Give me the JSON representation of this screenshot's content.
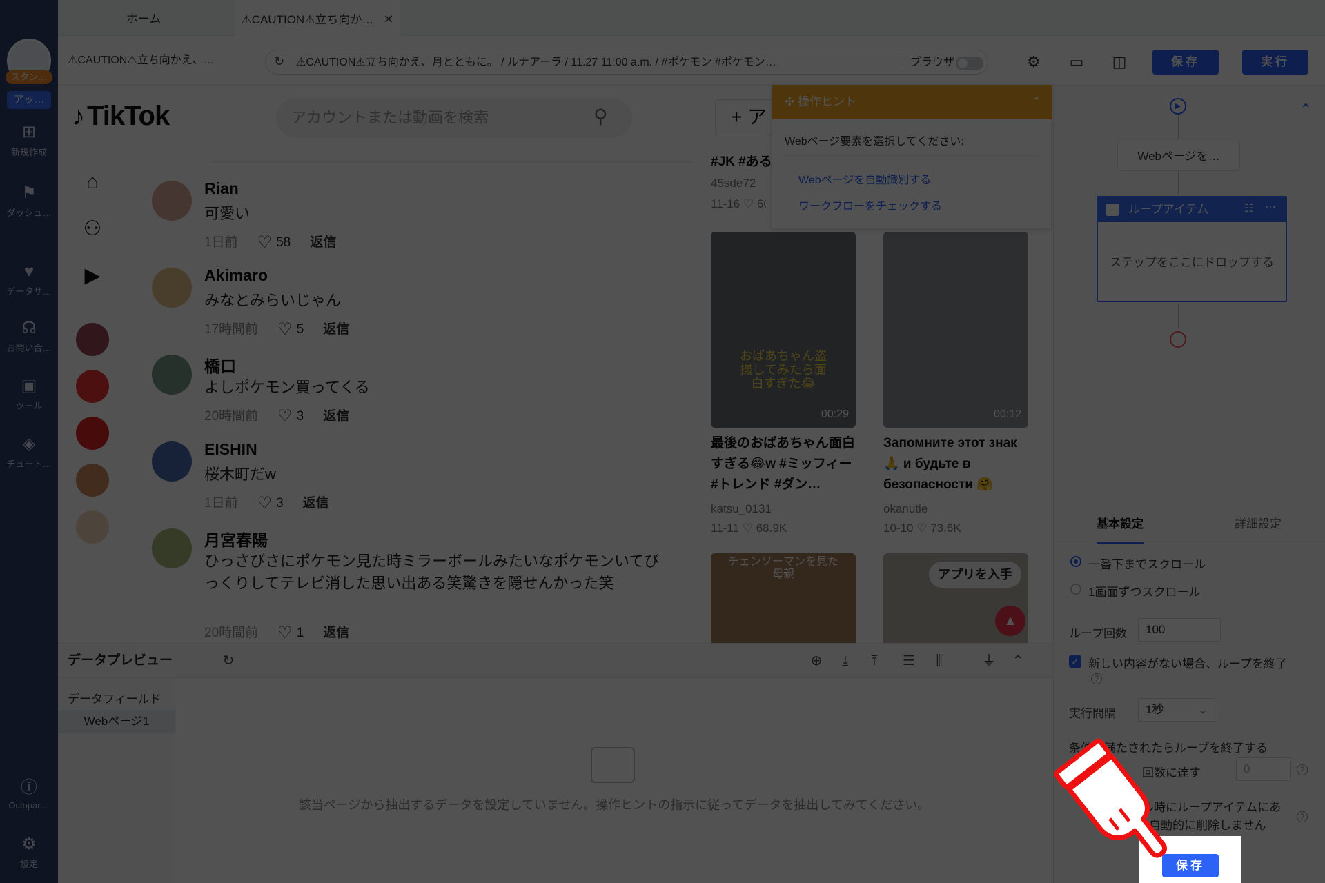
{
  "sidebar": {
    "profile_badge": "スタン…",
    "app_badge": "アッ…",
    "items": [
      {
        "label": "新規作成",
        "icon": "plus-icon"
      },
      {
        "label": "ダッシュ…",
        "icon": "dashboard-icon"
      },
      {
        "label": "データサ…",
        "icon": "data-icon"
      },
      {
        "label": "お問い合…",
        "icon": "headset-icon"
      },
      {
        "label": "ツール",
        "icon": "toolbox-icon"
      },
      {
        "label": "チュート…",
        "icon": "graduation-cap-icon"
      }
    ],
    "bottom_items": [
      {
        "label": "Octopar…",
        "icon": "info-icon"
      },
      {
        "label": "設定",
        "icon": "gear-icon"
      }
    ]
  },
  "tabs": [
    {
      "label": "ホーム"
    },
    {
      "label": "⚠CAUTION⚠立ち向か…"
    }
  ],
  "toolbar": {
    "breadcrumb": "⚠CAUTION⚠立ち向かえ、…",
    "url": "⚠CAUTION⚠立ち向かえ、月とともに。 / ルナアーラ / 11.27 11:00 a.m. / #ポケモン #ポケモン…",
    "browser_label": "ブラウザ",
    "save_label": "保存",
    "run_label": "実行"
  },
  "tiktok": {
    "logo": "TikTok",
    "search_placeholder": "アカウントまたは動画を検索",
    "upload_label": "+ ア",
    "comments": [
      {
        "name": "Rian",
        "text": "可愛い",
        "time": "1日前",
        "likes": "58",
        "reply": "返信"
      },
      {
        "name": "Akimaro",
        "text": "みなとみらいじゃん",
        "time": "17時間前",
        "likes": "5",
        "reply": "返信"
      },
      {
        "name": "橋口",
        "text": "よしポケモン買ってくる",
        "time": "20時間前",
        "likes": "3",
        "reply": "返信"
      },
      {
        "name": "EISHIN",
        "text": "桜木町だw",
        "time": "1日前",
        "likes": "3",
        "reply": "返信"
      },
      {
        "name": "月宮春陽",
        "text": "ひっさびさにポケモン見た時ミラーボールみたいなポケモンいてびっくりしてテレビ消した思い出ある笑驚きを隠せんかった笑",
        "time": "20時間前",
        "likes": "1",
        "reply": "返信"
      }
    ],
    "videos": [
      {
        "title": "#JK #ある",
        "author": "45sde72",
        "date": "11-16",
        "likes": "60"
      },
      {
        "title": "最後のおばあちゃん面白すぎる😂w #ミッフィー #トレンド #ダン…",
        "author": "katsu_0131",
        "date": "11-11",
        "likes": "68.9K",
        "duration": "00:29",
        "overlay": "おばあちゃん盗撮してみたら面白すぎた😂"
      },
      {
        "title": "Запомните этот знак 🙏 и будьте в безопасности 🤗",
        "author": "okanutie",
        "date": "10-10",
        "likes": "73.6K",
        "duration": "00:12"
      },
      {
        "overlay": "チェンソーマンを見た母親"
      },
      {
        "overlay": "アプリを入手"
      }
    ]
  },
  "hint": {
    "title": "操作ヒント",
    "prompt": "Webページ要素を選択してください:",
    "link_auto": "Webページを自動識別する",
    "link_check": "ワークフローをチェックする"
  },
  "workflow": {
    "node": "Webページを…",
    "loop_title": "ループアイテム",
    "drop_text": "ステップをここにドロップする"
  },
  "settings": {
    "tab_basic": "基本設定",
    "tab_detail": "詳細設定",
    "scroll_bottom": "一番下までスクロール",
    "scroll_page": "1画面ずつスクロール",
    "loop_count_label": "ループ回数",
    "loop_count": "100",
    "end_no_new": "新しい内容がない場合、ループを終了",
    "interval_label": "実行間隔",
    "interval": "1秒",
    "end_condition": "条件が満たされたらループを終了する",
    "reach_count": "回数に達す",
    "reach_value": "0",
    "loop_item_note_1": "ル時にループアイテムにあ",
    "loop_item_note_2": "自動的に削除しません",
    "save_label": "保存"
  },
  "preview": {
    "title": "データプレビュー",
    "field_label": "データフィールド",
    "page_label": "Webページ1",
    "empty_text": "該当ページから抽出するデータを設定していません。操作ヒントの指示に従ってデータを抽出してみてください。"
  },
  "colors": {
    "accent": "#2c62f5",
    "hint": "#f5a623",
    "sidebar": "#2f3e6d"
  }
}
